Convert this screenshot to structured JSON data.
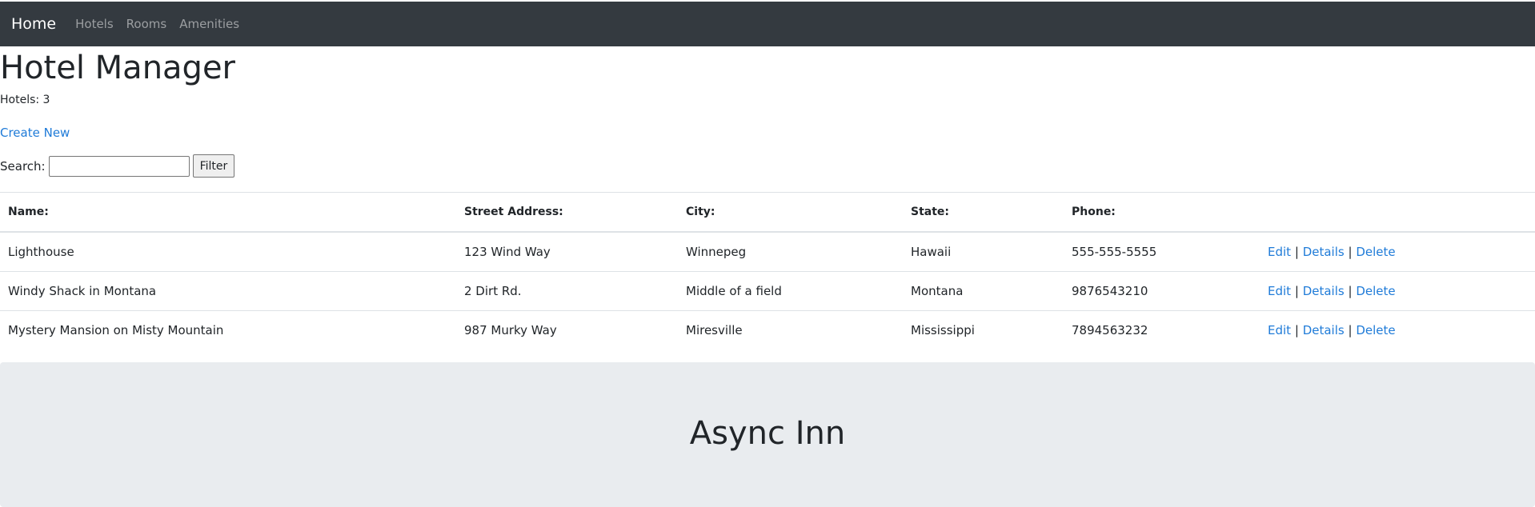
{
  "nav": {
    "brand": "Home",
    "links": [
      "Hotels",
      "Rooms",
      "Amenities"
    ]
  },
  "page": {
    "title": "Hotel Manager",
    "count_text": "Hotels: 3",
    "create_new": "Create New"
  },
  "search": {
    "label": "Search:",
    "value": "",
    "button": "Filter"
  },
  "table": {
    "headers": [
      "Name:",
      "Street Address:",
      "City:",
      "State:",
      "Phone:"
    ],
    "rows": [
      {
        "name": "Lighthouse",
        "street": "123 Wind Way",
        "city": "Winnepeg",
        "state": "Hawaii",
        "phone": "555-555-5555"
      },
      {
        "name": "Windy Shack in Montana",
        "street": "2 Dirt Rd.",
        "city": "Middle of a field",
        "state": "Montana",
        "phone": "9876543210"
      },
      {
        "name": "Mystery Mansion on Misty Mountain",
        "street": "987 Murky Way",
        "city": "Miresville",
        "state": "Mississippi",
        "phone": "7894563232"
      }
    ],
    "actions": {
      "edit": "Edit",
      "details": "Details",
      "delete": "Delete",
      "separator": "|"
    }
  },
  "footer": {
    "title": "Async Inn"
  },
  "colors": {
    "navbar": "#343a40",
    "link": "#1f7bd8",
    "jumbotron": "#e9ecef"
  }
}
